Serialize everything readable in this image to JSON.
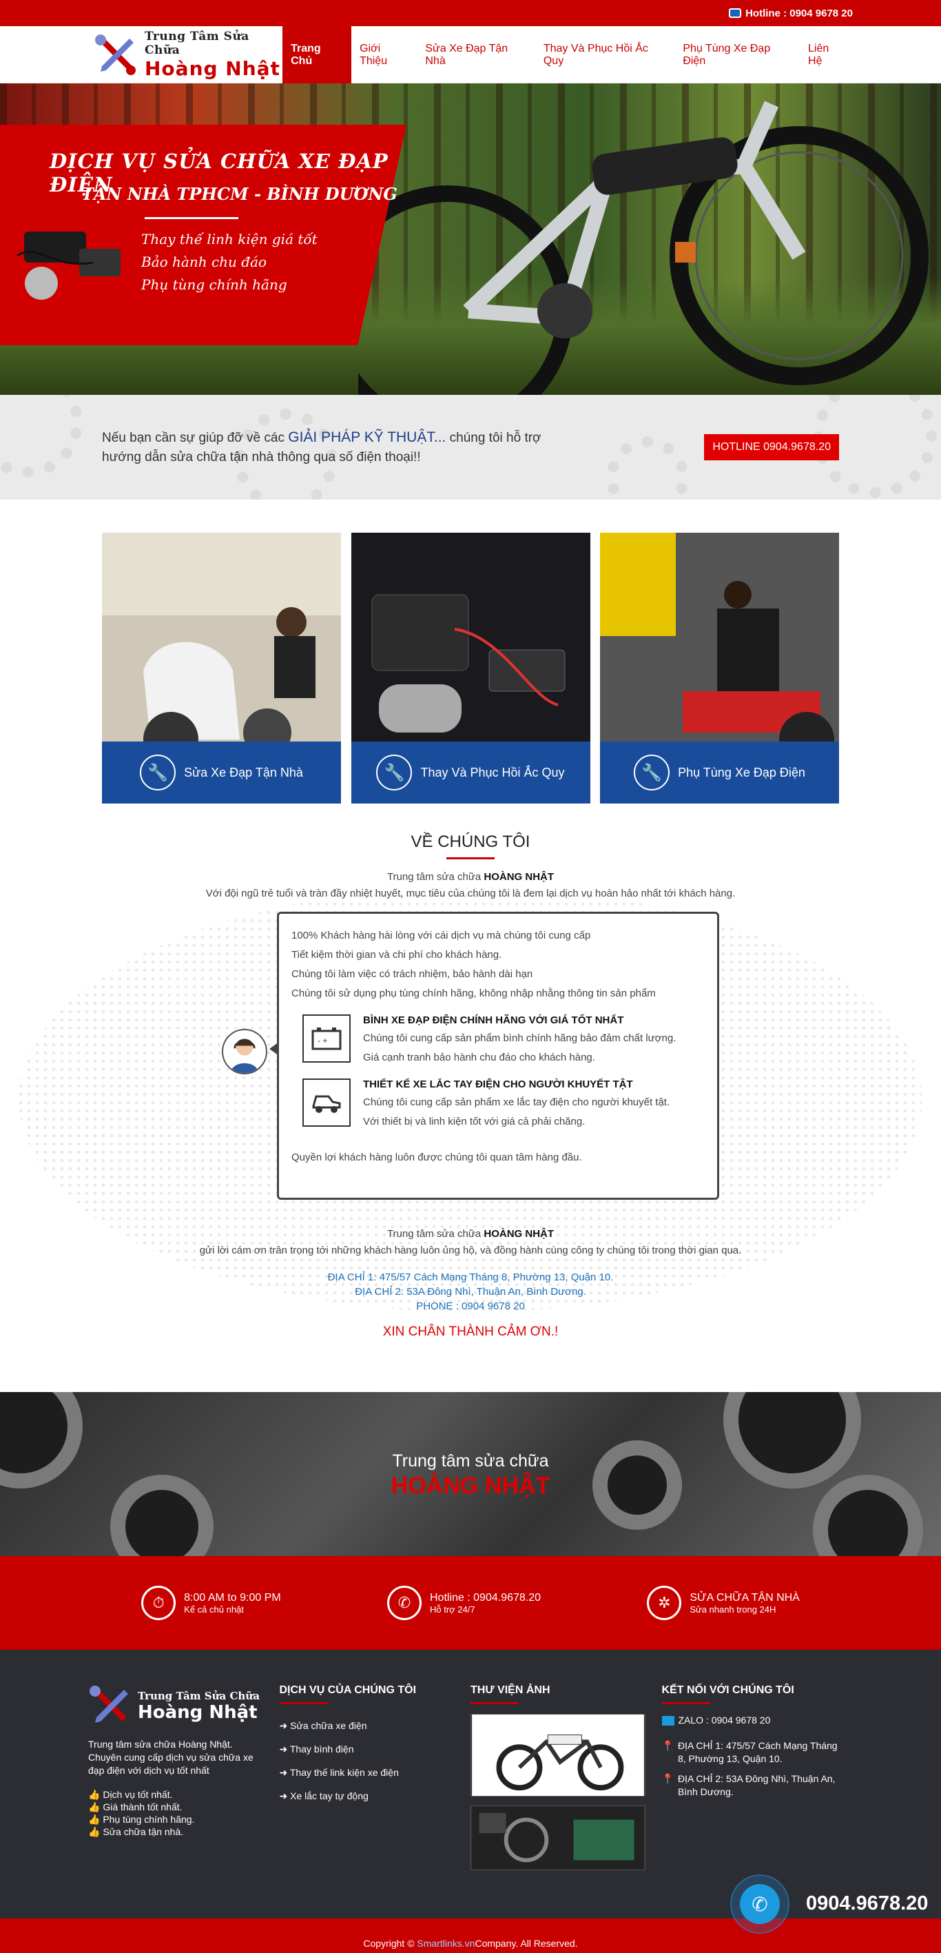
{
  "topbar": {
    "hotline": "Hotline : 0904 9678 20"
  },
  "logo": {
    "line1": "Trung Tâm Sửa Chữa",
    "line2": "Hoàng Nhật"
  },
  "nav": {
    "items": [
      "Trang Chủ",
      "Giới Thiệu",
      "Sửa Xe Đạp Tận Nhà",
      "Thay Và Phục Hồi Ắc Quy",
      "Phụ Tùng Xe Đạp Điện",
      "Liên Hệ"
    ],
    "active_index": 0
  },
  "hero": {
    "title": "Dịch vụ sửa chữa xe đạp điện",
    "subtitle": "Tận nhà TPHCM - Bình Dương",
    "bullets": [
      "Thay thế linh kiện giá tốt",
      "Bảo hành chu đáo",
      "Phụ tùng chính hãng"
    ]
  },
  "help": {
    "text_before": "Nếu bạn cần sự giúp đỡ về các ",
    "highlight": "GIẢI PHÁP KỸ THUẬT...",
    "text_after": " chúng tôi hỗ trợ hướng dẫn sửa chữa tận nhà thông qua số điện thoại!!",
    "button": "HOTLINE 0904.9678.20"
  },
  "services": [
    {
      "label": "Sửa Xe Đạp Tận Nhà",
      "icon": "wrench-icon"
    },
    {
      "label": "Thay Và Phục Hồi Ắc Quy",
      "icon": "wrench-icon"
    },
    {
      "label": "Phụ Tùng Xe Đạp Điện",
      "icon": "wrench-icon"
    }
  ],
  "about": {
    "title": "VỀ CHÚNG TÔI",
    "intro_prefix": "Trung tâm sửa chữa ",
    "intro_name": "HOÀNG NHẬT",
    "intro_text": "Với đội ngũ trẻ tuổi và tràn đầy nhiệt huyết, mục tiêu của chúng tôi là đem lại dịch vụ hoàn hảo nhất tới khách hàng.",
    "points": [
      "100% Khách hàng hài lòng với cái dịch vụ mà chúng tôi cung cấp",
      "Tiết kiệm thời gian và chi phí cho khách hàng.",
      "Chúng tôi làm việc có trách nhiệm, bảo hành dài hạn",
      "Chúng tôi sử dụng phụ tùng chính hãng, không nhập nhằng thông tin sản phẩm"
    ],
    "features": [
      {
        "title": "BÌNH XE ĐẠP ĐIỆN CHÍNH HÃNG VỚI GIÁ TỐT NHẤT",
        "line1": "Chúng tôi cung cấp sản phẩm bình chính hãng bảo đảm chất lượng.",
        "line2": "Giá cạnh tranh bảo hành chu đáo cho khách hàng.",
        "icon": "battery-icon"
      },
      {
        "title": "THIẾT KẾ XE LẮC TAY ĐIỆN CHO NGƯỜI KHUYẾT TẬT",
        "line1": "Chúng tôi cung cấp sản phẩm xe lắc tay điện cho người khuyết tật.",
        "line2": "Với thiết bị và linh kiện tốt với giá cả phải chăng.",
        "icon": "vehicle-icon"
      }
    ],
    "closing": "Quyền lợi khách hàng luôn được chúng tôi quan tâm hàng đầu.",
    "thanks_prefix": "Trung tâm sửa chữa ",
    "thanks_name": "HOÀNG NHẬT",
    "thanks_text": "gửi lời cám ơn trân trọng tới những khách hàng luôn ủng hộ, và đồng hành cùng công ty chúng tôi trong thời gian qua.",
    "address1": "ĐỊA CHỈ 1: 475/57 Cách Mạng Tháng 8, Phường 13, Quận 10.",
    "address2": "ĐỊA CHỈ 2: 53A Đông Nhì, Thuận An, Bình Dương.",
    "phone": "PHONE : 0904 9678 20",
    "final": "XIN CHÂN THÀNH CẢM ƠN.!"
  },
  "tools_banner": {
    "line1": "Trung tâm sửa chữa",
    "line2": "HOÀNG NHẬT"
  },
  "contact_bar": [
    {
      "t1": "8:00 AM to 9:00 PM",
      "t2": "Kể cả chủ nhật",
      "icon": "stopwatch-icon"
    },
    {
      "t1": "Hotline : 0904.9678.20",
      "t2": "Hỗ trợ 24/7",
      "icon": "phone-icon"
    },
    {
      "t1": "SỬA CHỮA TẬN NHÀ",
      "t2": "Sửa nhanh trong 24H",
      "icon": "gear-icon"
    }
  ],
  "footer": {
    "about_text": "Trung tâm sửa chữa Hoàng Nhật. Chuyên cung cấp dịch vụ sửa chữa xe đạp điện với dịch vụ tốt nhất",
    "checks": [
      "Dịch vụ tốt nhất.",
      "Giá thành tốt nhất.",
      "Phụ tùng chính hãng.",
      "Sửa chữa tận nhà."
    ],
    "services_title": "DỊCH VỤ CỦA CHÚNG TÔI",
    "services": [
      "Sửa chữa xe điện",
      "Thay bình điện",
      "Thay thế link kiện xe điện",
      "Xe lắc tay tự động"
    ],
    "gallery_title": "THƯ VIỆN ẢNH",
    "connect_title": "KẾT NỐI VỚI CHÚNG TÔI",
    "zalo": "ZALO : 0904 9678 20",
    "addr1": "ĐỊA CHỈ 1: 475/57 Cách Mạng Tháng 8, Phường 13, Quận 10.",
    "addr2": "ĐỊA CHỈ 2: 53A Đông Nhì, Thuận An, Bình Dương."
  },
  "copyright": {
    "prefix": "Copyright © ",
    "link": "Smartlinks.vn",
    "suffix": " Company. All Reserved."
  },
  "float_call": {
    "number": "0904.9678.20"
  },
  "colors": {
    "brand_red": "#c90000",
    "service_blue": "#1a4c9c",
    "footer_dark": "#2c2c33"
  }
}
